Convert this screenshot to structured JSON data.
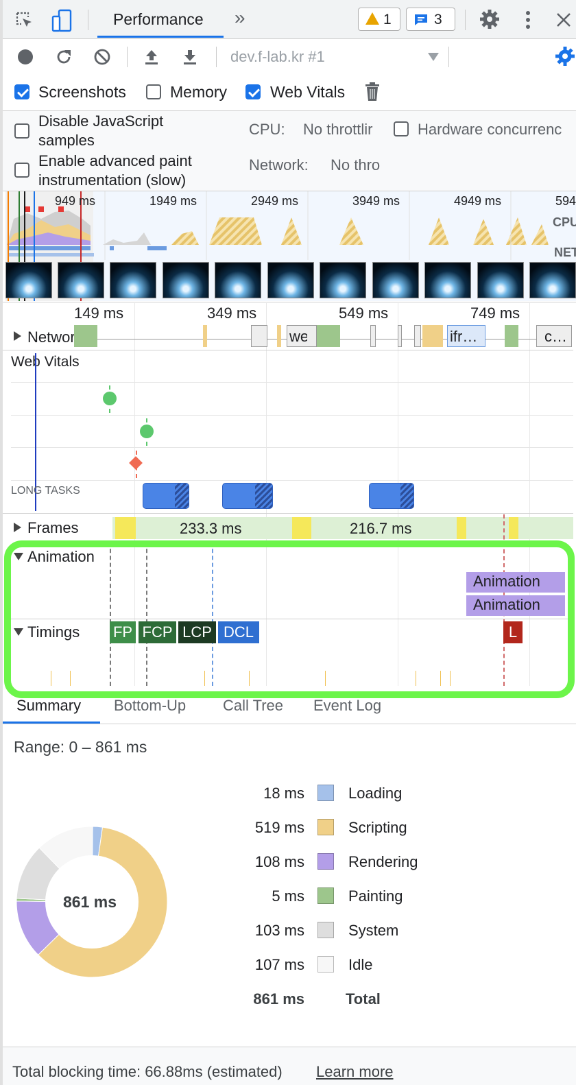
{
  "toolbar": {
    "active_tab": "Performance",
    "more_tabs_glyph": "»",
    "warning_count": "1",
    "message_count": "3",
    "recording_target": "dev.f-lab.kr #1",
    "options": {
      "screenshots": {
        "label": "Screenshots",
        "checked": true
      },
      "memory": {
        "label": "Memory",
        "checked": false
      },
      "web_vitals": {
        "label": "Web Vitals",
        "checked": true
      }
    }
  },
  "settings": {
    "disable_js_samples": {
      "label1": "Disable JavaScript",
      "label2": "samples",
      "checked": false
    },
    "advanced_paint": {
      "label1": "Enable advanced paint",
      "label2": "instrumentation (slow)",
      "checked": false
    },
    "cpu": {
      "label": "CPU:",
      "value": "No throttlir"
    },
    "network": {
      "label": "Network:",
      "value": "No thro"
    },
    "hardware": {
      "label": "Hardware concurrenc",
      "checked": false
    }
  },
  "overview": {
    "ticks": [
      "949 ms",
      "1949 ms",
      "2949 ms",
      "3949 ms",
      "4949 ms",
      "594"
    ],
    "cpu_label": "CPU",
    "net_label": "NET"
  },
  "timeline": {
    "ruler_ticks": [
      "149 ms",
      "349 ms",
      "549 ms",
      "749 ms"
    ],
    "network_label": "Network",
    "network_chips": [
      "we",
      "ifr…",
      "c…"
    ],
    "web_vitals_label": "Web Vitals",
    "long_tasks_label": "LONG TASKS",
    "frames_label": "Frames",
    "frame_durations": [
      "233.3 ms",
      "216.7 ms"
    ],
    "animation_label": "Animation",
    "animation_blocks": [
      "Animation",
      "Animation"
    ],
    "timings_label": "Timings",
    "timing_markers": [
      "FP",
      "FCP",
      "LCP",
      "DCL",
      "L"
    ]
  },
  "bottom_tabs": [
    "Summary",
    "Bottom-Up",
    "Call Tree",
    "Event Log"
  ],
  "summary": {
    "range": "Range: 0 – 861 ms",
    "center": "861 ms",
    "rows": [
      {
        "value": "18 ms",
        "name": "Loading",
        "color": "#a5c1ea"
      },
      {
        "value": "519 ms",
        "name": "Scripting",
        "color": "#f0d088"
      },
      {
        "value": "108 ms",
        "name": "Rendering",
        "color": "#b39ee8"
      },
      {
        "value": "5 ms",
        "name": "Painting",
        "color": "#9dc68c"
      },
      {
        "value": "103 ms",
        "name": "System",
        "color": "#dedede"
      },
      {
        "value": "107 ms",
        "name": "Idle",
        "color": "#f7f7f7"
      }
    ],
    "total_value": "861 ms",
    "total_label": "Total"
  },
  "footer": {
    "tbt": "Total blocking time: 66.88ms (estimated)",
    "link": "Learn more"
  },
  "colors": {
    "accent": "#1a73e8",
    "highlight": "#6cf54a",
    "scripting": "#f0d088",
    "rendering": "#b39ee8",
    "fp": "#3e8e49",
    "fcp": "#2d6b37",
    "lcp": "#1d3a23",
    "dcl": "#2f6fd1",
    "load": "#b2271c"
  }
}
